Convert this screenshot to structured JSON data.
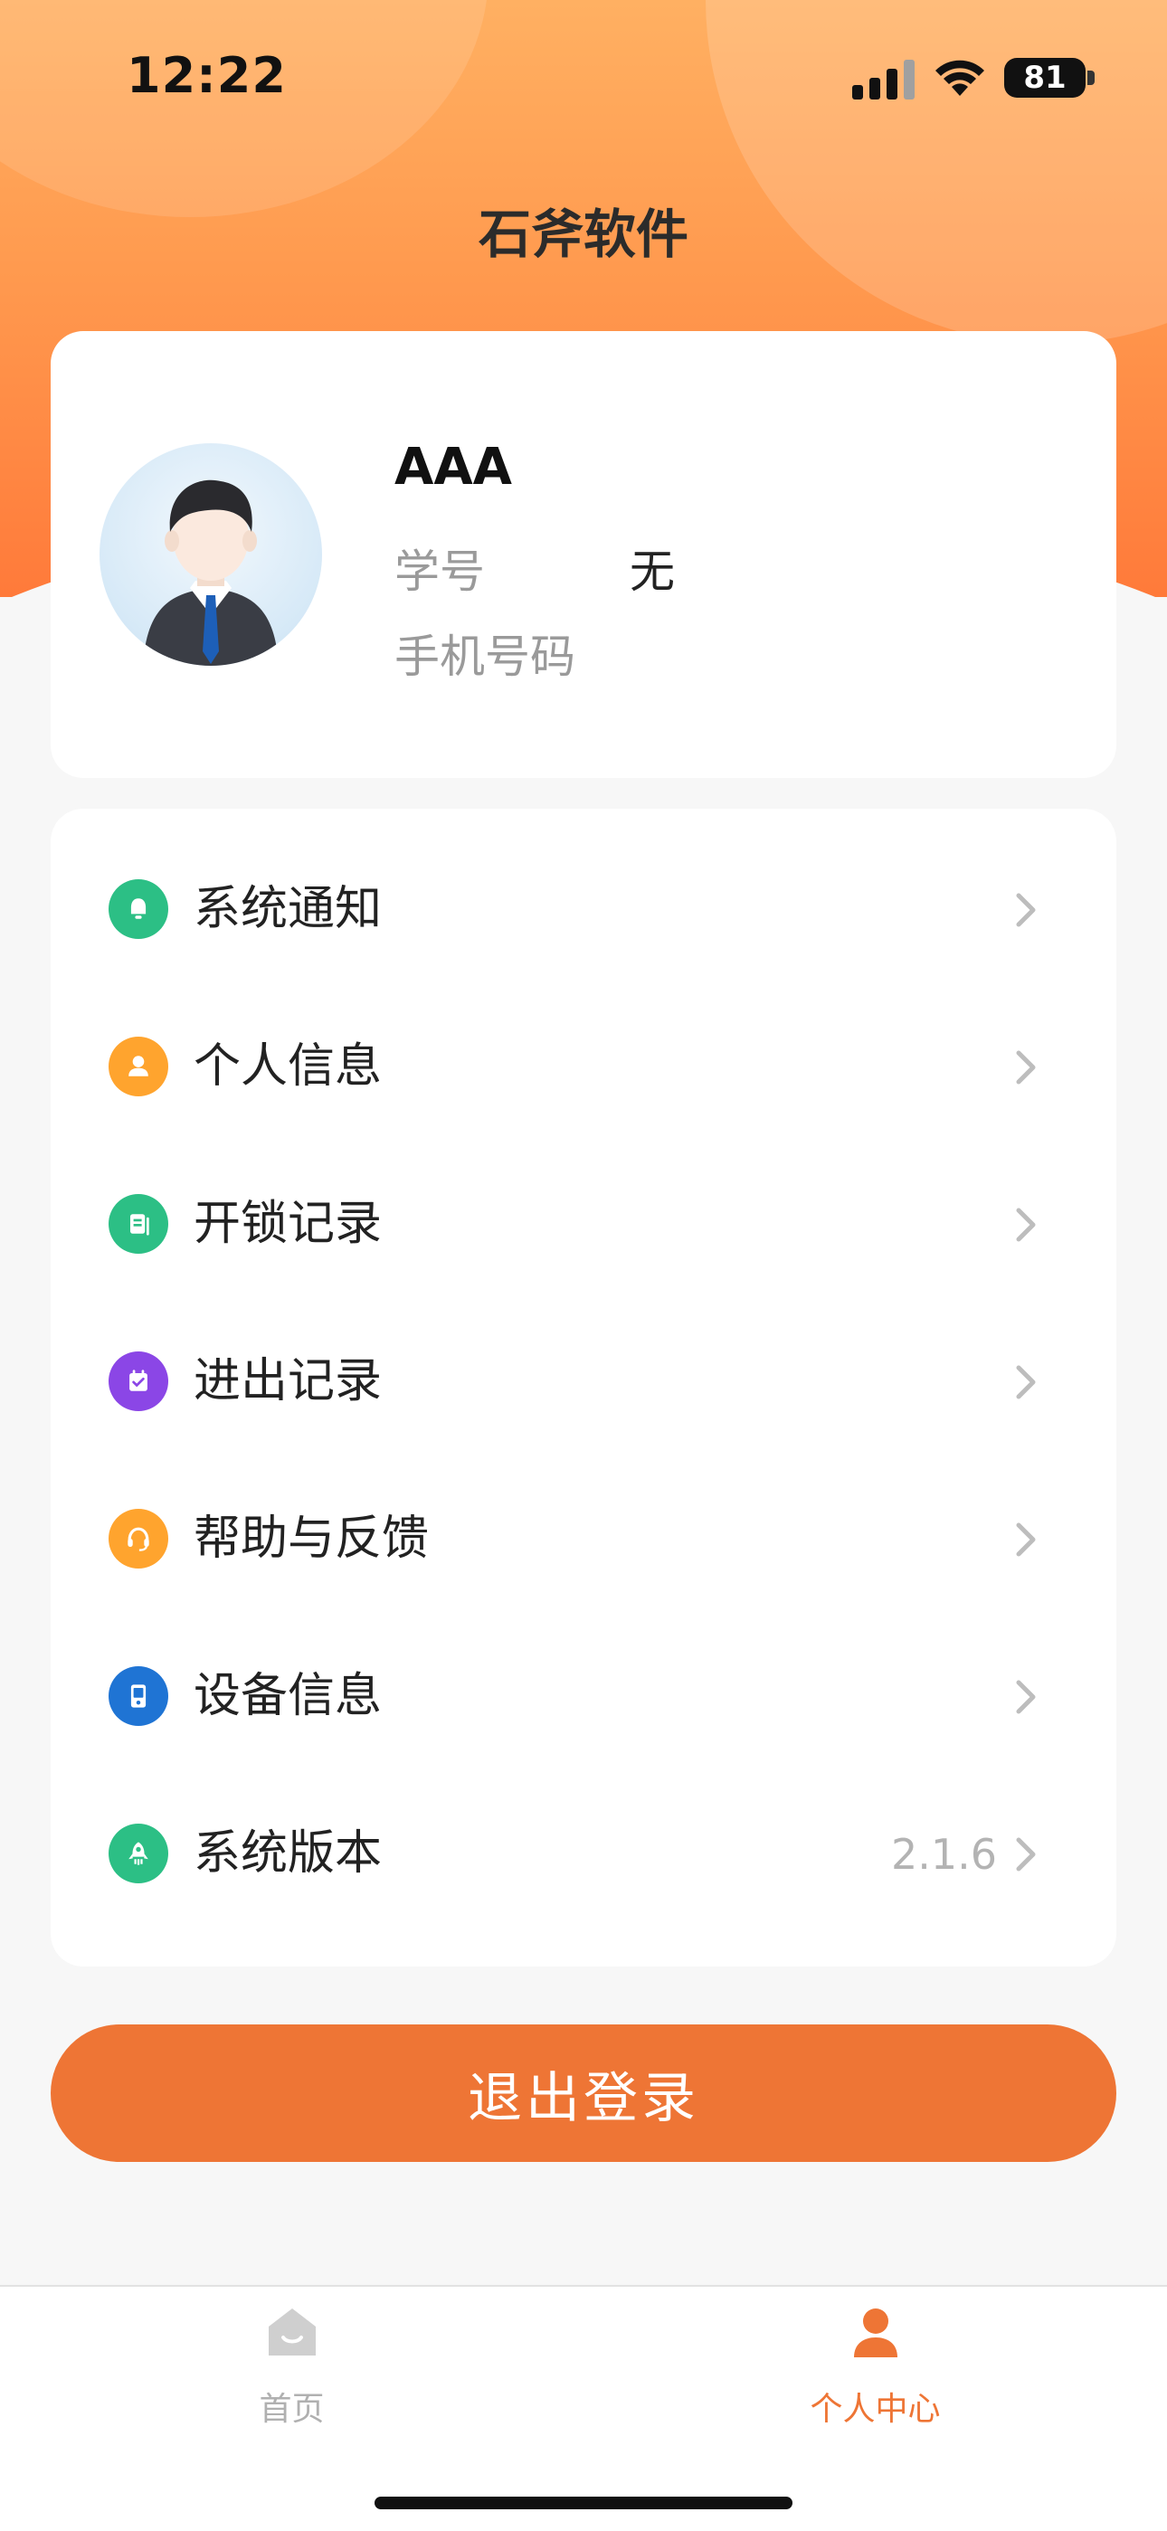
{
  "status_bar": {
    "time": "12:22",
    "battery": "81"
  },
  "header": {
    "title": "石斧软件"
  },
  "profile": {
    "name": "AAA",
    "student_id_label": "学号",
    "student_id_value": "无",
    "phone_label": "手机号码",
    "phone_value": ""
  },
  "menu": {
    "items": [
      {
        "label": "系统通知",
        "icon": "bell-icon",
        "color": "#2cbf85",
        "value": ""
      },
      {
        "label": "个人信息",
        "icon": "person-icon",
        "color": "#ffa42e",
        "value": ""
      },
      {
        "label": "开锁记录",
        "icon": "document-icon",
        "color": "#2cbf85",
        "value": ""
      },
      {
        "label": "进出记录",
        "icon": "calendar-check-icon",
        "color": "#8b46e6",
        "value": ""
      },
      {
        "label": "帮助与反馈",
        "icon": "headset-icon",
        "color": "#ffa42e",
        "value": ""
      },
      {
        "label": "设备信息",
        "icon": "device-icon",
        "color": "#1f74d4",
        "value": ""
      },
      {
        "label": "系统版本",
        "icon": "rocket-icon",
        "color": "#2cbf85",
        "value": "2.1.6"
      }
    ]
  },
  "logout": {
    "label": "退出登录"
  },
  "tabbar": {
    "tabs": [
      {
        "label": "首页",
        "icon": "home-icon",
        "active": false
      },
      {
        "label": "个人中心",
        "icon": "user-icon",
        "active": true
      }
    ]
  },
  "colors": {
    "accent": "#ee7535",
    "inactive": "#b0b0b0"
  }
}
